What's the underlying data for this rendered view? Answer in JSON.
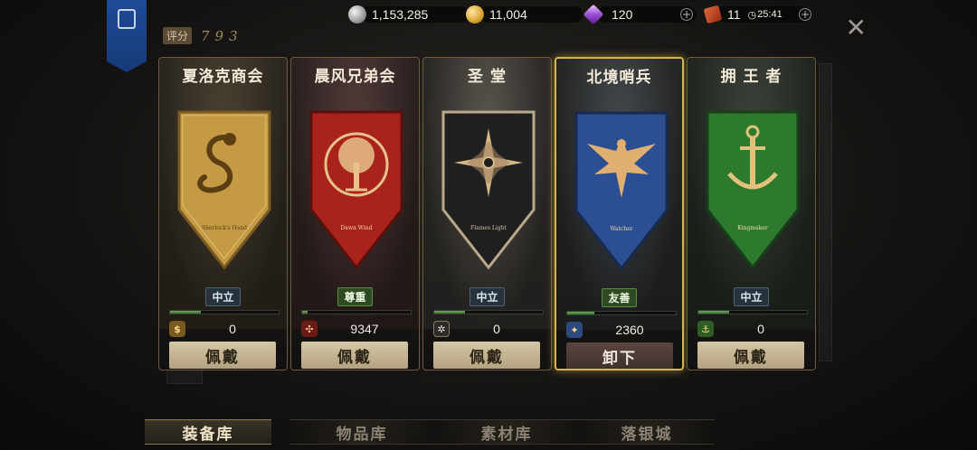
{
  "resources": {
    "silver": "1,153,285",
    "gold": "11,004",
    "gems": "120",
    "tickets": "11",
    "timer": "25:41"
  },
  "header": {
    "score_label": "评分",
    "score_value": "793"
  },
  "factions": [
    {
      "name": "夏洛克商会",
      "motto": "Sherlock's Hand",
      "relation": "中立",
      "relation_type": "neutral",
      "points": "0",
      "progress": 0.28,
      "button": "佩戴",
      "color": "#b58f3e",
      "badge_color": "#7a5a1e",
      "selected": false
    },
    {
      "name": "晨风兄弟会",
      "motto": "Dawn Wind",
      "relation": "尊重",
      "relation_type": "green",
      "points": "9347",
      "progress": 0.05,
      "button": "佩戴",
      "color": "#a8231c",
      "badge_color": "#6b1a16",
      "selected": false
    },
    {
      "name": "圣 堂",
      "motto": "Flames Light",
      "relation": "中立",
      "relation_type": "neutral",
      "points": "0",
      "progress": 0.28,
      "button": "佩戴",
      "color": "#1f1f1f",
      "badge_color": "#2b2b2b",
      "selected": false
    },
    {
      "name": "北境哨兵",
      "motto": "Watcher",
      "relation": "友善",
      "relation_type": "green",
      "points": "2360",
      "progress": 0.25,
      "button": "卸下",
      "color": "#2c4f93",
      "badge_color": "#2b4a7d",
      "selected": true
    },
    {
      "name": "拥 王 者",
      "motto": "Kingmaker",
      "relation": "中立",
      "relation_type": "neutral",
      "points": "0",
      "progress": 0.28,
      "button": "佩戴",
      "color": "#2d7a2e",
      "badge_color": "#2f5e24",
      "selected": false
    }
  ],
  "tabs": [
    "装备库",
    "物品库",
    "素材库",
    "落银城"
  ]
}
